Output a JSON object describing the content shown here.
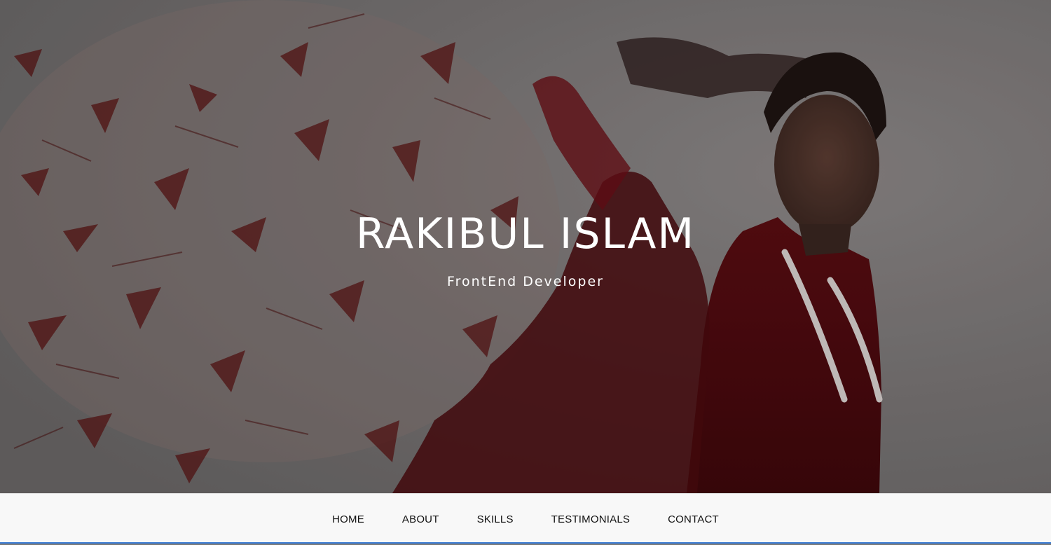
{
  "hero": {
    "title": "RAKIBUL ISLAM",
    "subtitle": "FrontEnd Developer"
  },
  "nav": {
    "items": [
      {
        "label": "HOME"
      },
      {
        "label": "ABOUT"
      },
      {
        "label": "SKILLS"
      },
      {
        "label": "TESTIMONIALS"
      },
      {
        "label": "CONTACT"
      }
    ]
  },
  "colors": {
    "nav_background": "#f8f8f8",
    "nav_bottom_border": "#3a7bd5",
    "hero_text": "#ffffff",
    "splatter": "#5a1414"
  },
  "icons": [
    "hero-background-image"
  ]
}
